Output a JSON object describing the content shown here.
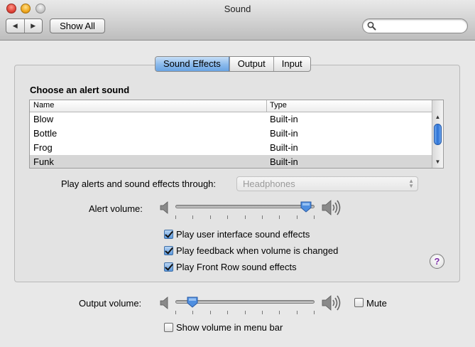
{
  "window": {
    "title": "Sound",
    "nav_back": "◀",
    "nav_forward": "▶",
    "show_all_label": "Show All"
  },
  "search": {
    "placeholder": "",
    "value": ""
  },
  "tabs": [
    {
      "label": "Sound Effects",
      "active": true
    },
    {
      "label": "Output",
      "active": false
    },
    {
      "label": "Input",
      "active": false
    }
  ],
  "sound_effects": {
    "heading": "Choose an alert sound",
    "table": {
      "columns": [
        "Name",
        "Type"
      ],
      "rows": [
        {
          "name": "Blow",
          "type": "Built-in",
          "selected": false
        },
        {
          "name": "Bottle",
          "type": "Built-in",
          "selected": false
        },
        {
          "name": "Frog",
          "type": "Built-in",
          "selected": false
        },
        {
          "name": "Funk",
          "type": "Built-in",
          "selected": true
        }
      ]
    },
    "play_through_label": "Play alerts and sound effects through:",
    "play_through_value": "Headphones",
    "alert_volume_label": "Alert volume:",
    "alert_volume_level": 0.98,
    "checkboxes": [
      {
        "label": "Play user interface sound effects",
        "checked": true
      },
      {
        "label": "Play feedback when volume is changed",
        "checked": true
      },
      {
        "label": "Play Front Row sound effects",
        "checked": true
      }
    ],
    "help_label": "?"
  },
  "output": {
    "volume_label": "Output volume:",
    "volume_level": 0.09,
    "mute_label": "Mute",
    "mute_checked": false,
    "menu_bar_label": "Show volume in menu bar",
    "menu_bar_checked": false
  },
  "colors": {
    "accent": "#5a97dc",
    "help_glyph": "#7d2da8"
  }
}
